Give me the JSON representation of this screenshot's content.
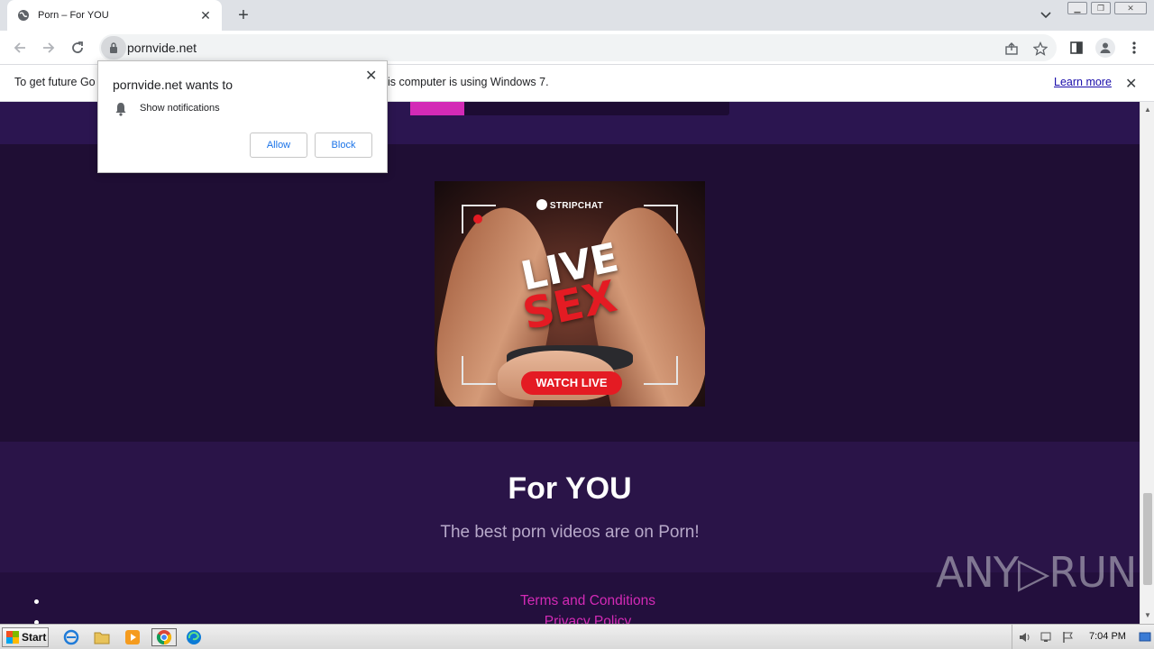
{
  "browser": {
    "tab": {
      "title": "Porn – For YOU",
      "close_glyph": "✕"
    },
    "new_tab_glyph": "+",
    "address": {
      "url": "pornvide.net"
    },
    "infobar": {
      "message_left": "To get future Go",
      "message_right": "is computer is using Windows 7.",
      "learn_more": "Learn more",
      "close_glyph": "✕"
    }
  },
  "permission_popup": {
    "title": "pornvide.net wants to",
    "permission": "Show notifications",
    "allow_label": "Allow",
    "block_label": "Block",
    "close_glyph": "✕"
  },
  "page": {
    "progress_fraction": 0.17,
    "ad": {
      "brand": "STRIPCHAT",
      "headline_1": "LIVE",
      "headline_2": "SEX",
      "cta": "WATCH LIVE"
    },
    "heading": "For YOU",
    "subheading": "The best porn videos are on Porn!",
    "footer_links": [
      "Terms and Conditions",
      "Privacy Policy"
    ],
    "watermark": "ANY▷RUN"
  },
  "taskbar": {
    "start_label": "Start",
    "clock": "7:04 PM"
  },
  "colors": {
    "page_bg": "#1f0e34",
    "accent_pink": "#d32ab6",
    "ad_red": "#e41b23"
  },
  "icons": [
    "globe-icon",
    "lock-icon",
    "share-icon",
    "star-icon",
    "sidepanel-icon",
    "profile-icon",
    "kebab-menu-icon",
    "bell-icon",
    "back-icon",
    "forward-icon",
    "reload-icon"
  ]
}
